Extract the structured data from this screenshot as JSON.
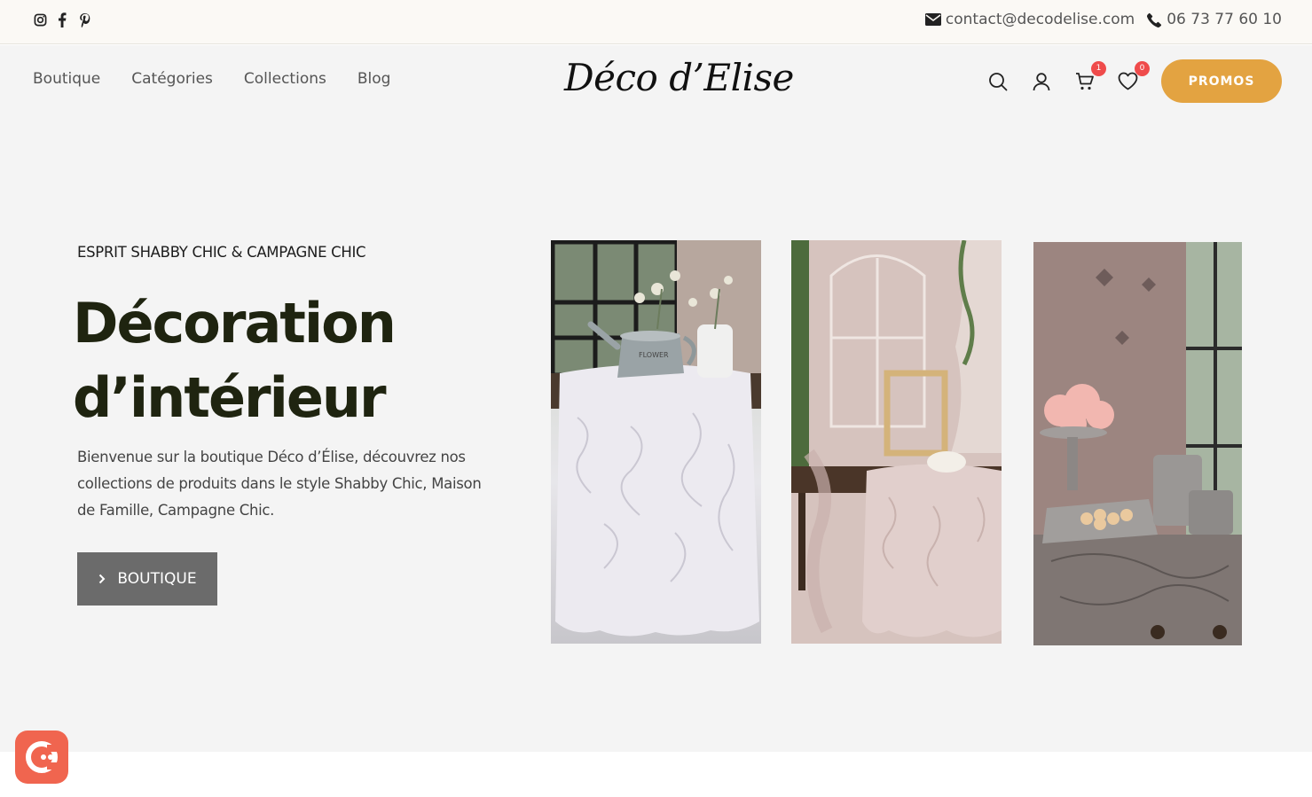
{
  "topbar": {
    "social": [
      "instagram-icon",
      "facebook-icon",
      "pinterest-icon"
    ],
    "email": "contact@decodelise.com",
    "phone": "06 73 77 60 10"
  },
  "header": {
    "nav": [
      "Boutique",
      "Catégories",
      "Collections",
      "Blog"
    ],
    "logo": "Déco d’Elise",
    "cart_count": "1",
    "wishlist_count": "0",
    "promos_label": "PROMOS"
  },
  "hero": {
    "kicker": "ESPRIT SHABBY CHIC & CAMPAGNE CHIC",
    "headline_line1": "Décoration",
    "headline_line2": "d’intérieur",
    "intro": "Bienvenue sur la boutique Déco d’Élise, découvrez nos collections de produits dans le style Shabby Chic, Maison de Famille, Campagne Chic.",
    "cta_label": "BOUTIQUE"
  },
  "colors": {
    "accent": "#e3a341",
    "badge": "#ef4b4b",
    "cta_bg": "#6b6b6b",
    "chat": "#f0654f"
  }
}
